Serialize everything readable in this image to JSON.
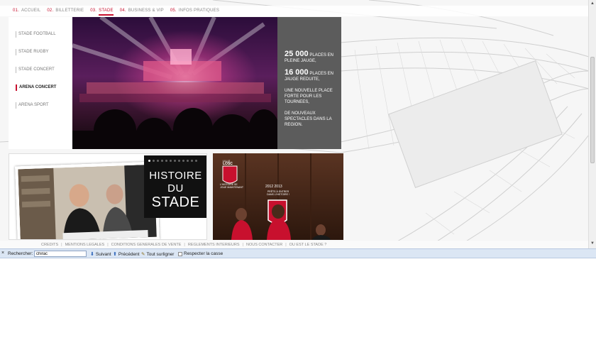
{
  "topnav": {
    "items": [
      {
        "num": "01.",
        "label": "ACCUEIL"
      },
      {
        "num": "02.",
        "label": "BILLETTERIE"
      },
      {
        "num": "03.",
        "label": "STADE"
      },
      {
        "num": "04.",
        "label": "BUSINESS & VIP"
      },
      {
        "num": "05.",
        "label": "INFOS PRATIQUES"
      }
    ]
  },
  "side_menu": {
    "items": [
      {
        "label": "STADE FOOTBALL"
      },
      {
        "label": "STADE RUGBY"
      },
      {
        "label": "STADE CONCERT"
      },
      {
        "label": "ARENA CONCERT"
      },
      {
        "label": "ARENA SPORT"
      }
    ]
  },
  "info_box": {
    "stat1_value": "25 000",
    "stat1_text": "PLACES EN PLEINE JAUGE,",
    "stat2_value": "16 000",
    "stat2_text": "PLACES EN JAUGE REDUITE,",
    "para1": "UNE NOUVELLE PLACE FORTE POUR LES TOURNEES,",
    "para2": "DE NOUVEAUX SPECTACLES DANS LA REGION."
  },
  "history": {
    "line1": "HISTOIRE",
    "line2": "DU",
    "line3": "STADE"
  },
  "losc": {
    "top": "LILLE",
    "name": "LOSC",
    "tagline": "L'HISTOIRE SE JOUE MAINTENANT",
    "years": "2012 2013",
    "slogan": "PRÊTS À ENTRER DANS L'HISTOIRE !"
  },
  "footer": {
    "links": [
      "CREDITS",
      "MENTIONS LEGALES",
      "CONDITIONS GENERALES DE VENTE",
      "REGLEMENTS INTERIEURS",
      "NOUS CONTACTER",
      "OU EST LE STADE ?"
    ]
  },
  "findbar": {
    "close": "×",
    "label": "Rechercher:",
    "value": "chirac",
    "next": "Suivant",
    "prev": "Précédent",
    "highlight": "Tout surligner",
    "match_case": "Respecter la casse"
  },
  "colors": {
    "accent": "#c8102e",
    "info_box_bg": "#5c5c5c",
    "findbar_bg": "#dbe6f4"
  }
}
